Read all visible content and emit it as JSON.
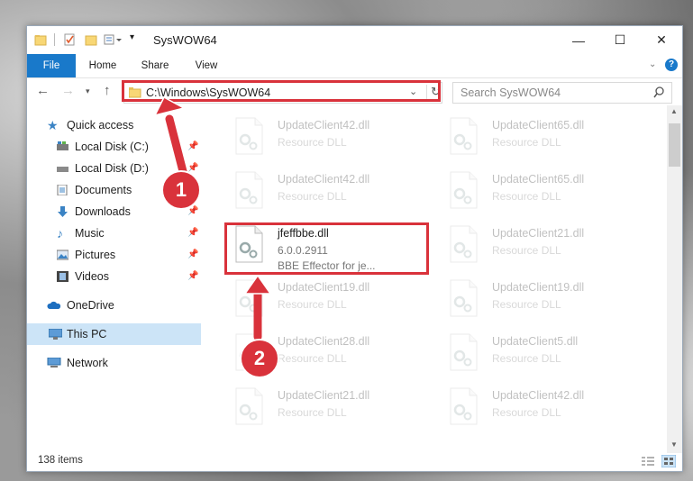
{
  "window": {
    "title": "SysWOW64",
    "minimize": "—",
    "maximize": "☐",
    "close": "✕"
  },
  "ribbon": {
    "tabs": [
      "File",
      "Home",
      "Share",
      "View"
    ],
    "help": "?"
  },
  "nav": {
    "address": "C:\\Windows\\SysWOW64",
    "search_placeholder": "Search SysWOW64"
  },
  "sidebar": {
    "quick_access": "Quick access",
    "items": [
      {
        "label": "Local Disk (C:)",
        "icon": "drive-icon",
        "pinned": true
      },
      {
        "label": "Local Disk (D:)",
        "icon": "drive-icon",
        "pinned": true
      },
      {
        "label": "Documents",
        "icon": "documents-icon",
        "pinned": true
      },
      {
        "label": "Downloads",
        "icon": "download-icon",
        "pinned": true
      },
      {
        "label": "Music",
        "icon": "music-icon",
        "pinned": true
      },
      {
        "label": "Pictures",
        "icon": "pictures-icon",
        "pinned": true
      },
      {
        "label": "Videos",
        "icon": "videos-icon",
        "pinned": true
      }
    ],
    "onedrive": "OneDrive",
    "this_pc": "This PC",
    "network": "Network"
  },
  "files": {
    "left": [
      {
        "name": "UpdateClient42.dll",
        "desc": "Resource DLL"
      },
      {
        "name": "UpdateClient42.dll",
        "desc": "Resource DLL"
      },
      {
        "name": "jfeffbbe.dll",
        "version": "6.0.0.2911",
        "desc": "BBE Effector for je..."
      },
      {
        "name": "UpdateClient19.dll",
        "desc": "Resource DLL"
      },
      {
        "name": "UpdateClient28.dll",
        "desc": "Resource DLL"
      },
      {
        "name": "UpdateClient21.dll",
        "desc": "Resource DLL"
      }
    ],
    "right": [
      {
        "name": "UpdateClient65.dll",
        "desc": "Resource DLL"
      },
      {
        "name": "UpdateClient65.dll",
        "desc": "Resource DLL"
      },
      {
        "name": "UpdateClient21.dll",
        "desc": "Resource DLL"
      },
      {
        "name": "UpdateClient19.dll",
        "desc": "Resource DLL"
      },
      {
        "name": "UpdateClient5.dll",
        "desc": "Resource DLL"
      },
      {
        "name": "UpdateClient42.dll",
        "desc": "Resource DLL"
      }
    ]
  },
  "status": {
    "count": "138 items"
  },
  "annotations": {
    "step1": "1",
    "step2": "2",
    "color": "#d9323b"
  }
}
